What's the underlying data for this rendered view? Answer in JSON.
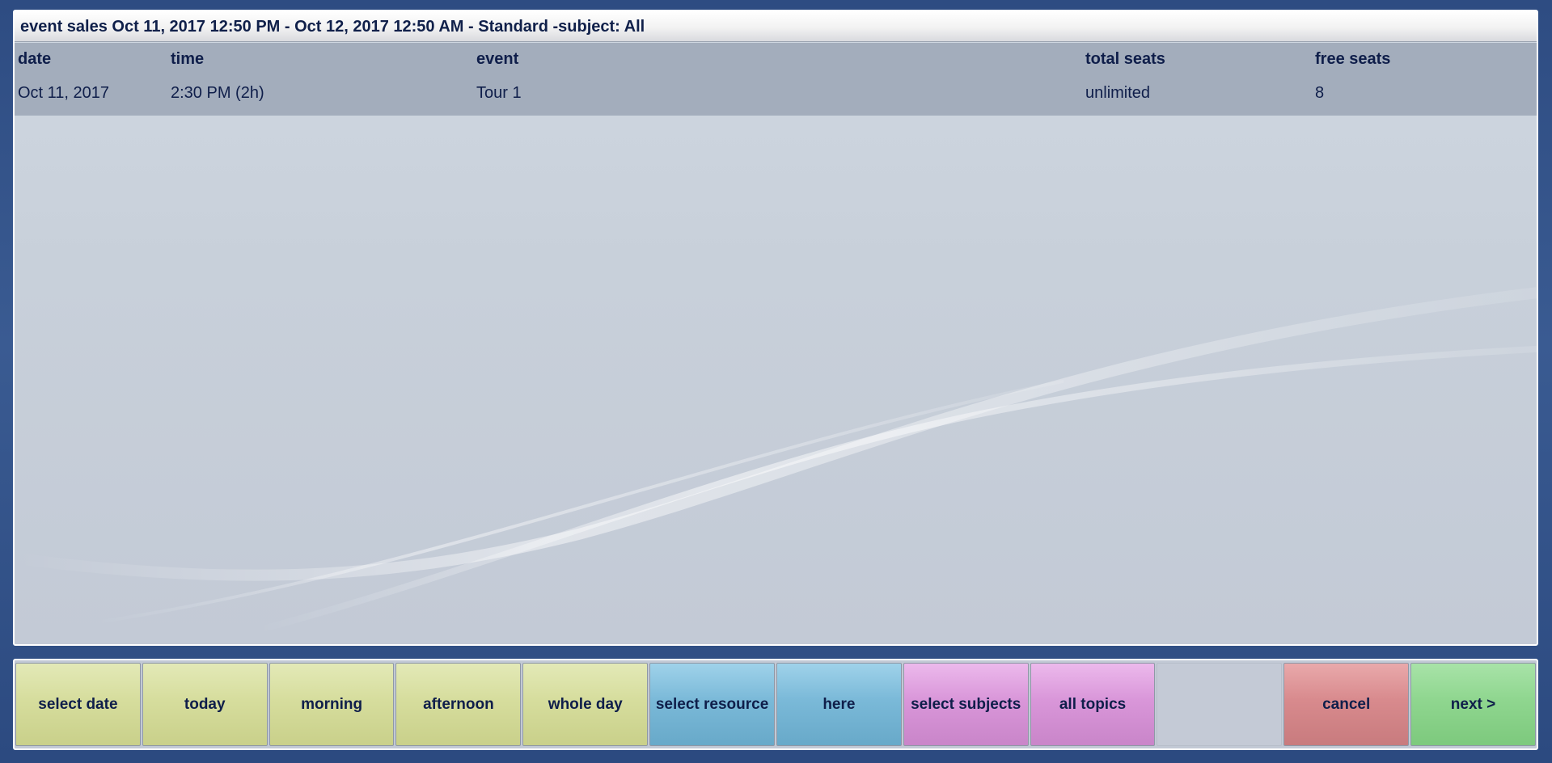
{
  "window": {
    "title": "event sales Oct 11, 2017 12:50 PM - Oct 12, 2017 12:50 AM - Standard -subject: All"
  },
  "table": {
    "columns": [
      "date",
      "time",
      "event",
      "total seats",
      "free seats"
    ],
    "rows": [
      [
        "Oct 11, 2017",
        "2:30 PM (2h)",
        "Tour 1",
        "unlimited",
        "8"
      ]
    ]
  },
  "buttons": [
    {
      "label": "select date",
      "color": "#d6dd9d"
    },
    {
      "label": "today",
      "color": "#d6dd9d"
    },
    {
      "label": "morning",
      "color": "#d6dd9d"
    },
    {
      "label": "afternoon",
      "color": "#d6dd9d"
    },
    {
      "label": "whole day",
      "color": "#d6dd9d"
    },
    {
      "label": "select resource",
      "color": "#7ab9d8"
    },
    {
      "label": "here",
      "color": "#7ab9d8"
    },
    {
      "label": "select subjects",
      "color": "#d996d9"
    },
    {
      "label": "all topics",
      "color": "#d996d9"
    },
    {
      "label": "",
      "color": "#c4cad6"
    },
    {
      "label": "cancel",
      "color": "#d88a8d"
    },
    {
      "label": "next >",
      "color": "#8fd68f"
    }
  ]
}
